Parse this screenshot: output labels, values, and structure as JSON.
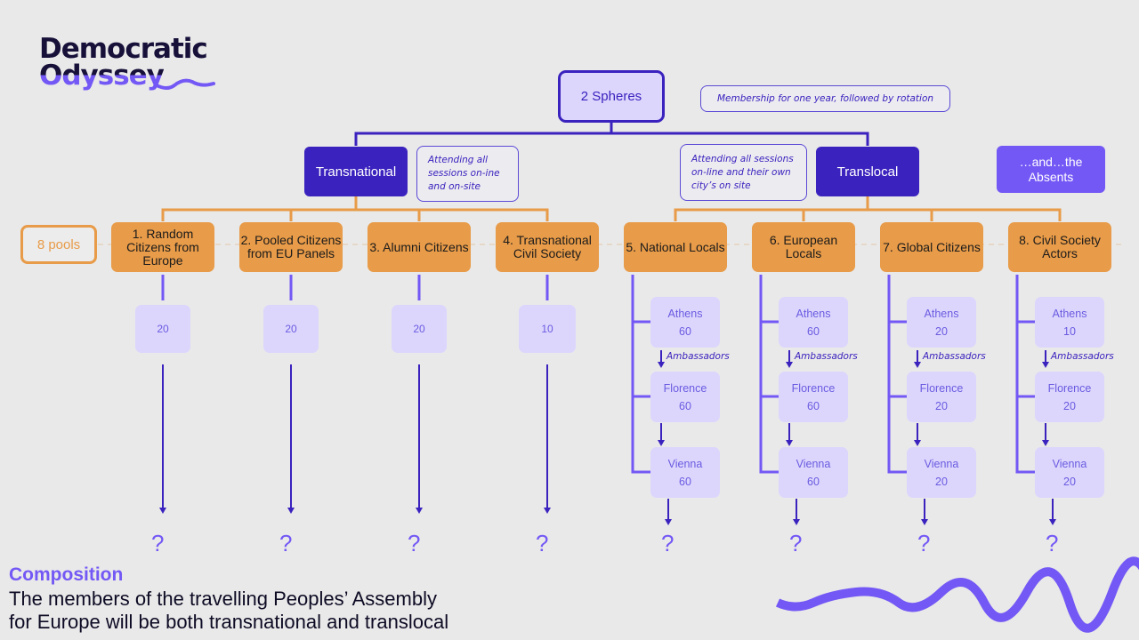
{
  "logo": {
    "line1": "Democratic",
    "line2": "Odyssey"
  },
  "colors": {
    "dark_purple": "#3a22be",
    "mid_purple": "#7458f5",
    "light_purple": "#dcd6fd",
    "orange": "#e89b48",
    "background": "#e9e9e9"
  },
  "root": {
    "label": "2 Spheres",
    "note": "Membership for one year, followed by rotation"
  },
  "spheres": {
    "transnational": {
      "label": "Transnational",
      "note": "Attending all sessions on-ine and on-site"
    },
    "translocal": {
      "label": "Translocal",
      "note": "Attending all sessions on-line and their own city’s on site"
    },
    "absents": {
      "label": "…and…the Absents"
    }
  },
  "pools_label": "8 pools",
  "pools": [
    {
      "label": "1. Random Citizens from Europe",
      "count": "20"
    },
    {
      "label": "2. Pooled Citizens from EU Panels",
      "count": "20"
    },
    {
      "label": "3. Alumni Citizens",
      "count": "20"
    },
    {
      "label": "4. Transnational Civil Society",
      "count": "10"
    },
    {
      "label": "5. National Locals",
      "cities": [
        {
          "name": "Athens",
          "count": "60"
        },
        {
          "name": "Florence",
          "count": "60"
        },
        {
          "name": "Vienna",
          "count": "60"
        }
      ]
    },
    {
      "label": "6. European Locals",
      "cities": [
        {
          "name": "Athens",
          "count": "60"
        },
        {
          "name": "Florence",
          "count": "60"
        },
        {
          "name": "Vienna",
          "count": "60"
        }
      ]
    },
    {
      "label": "7. Global Citizens",
      "cities": [
        {
          "name": "Athens",
          "count": "20"
        },
        {
          "name": "Florence",
          "count": "20"
        },
        {
          "name": "Vienna",
          "count": "20"
        }
      ]
    },
    {
      "label": "8. Civil Society Actors",
      "cities": [
        {
          "name": "Athens",
          "count": "10"
        },
        {
          "name": "Florence",
          "count": "20"
        },
        {
          "name": "Vienna",
          "count": "20"
        }
      ]
    }
  ],
  "ambassadors_label": "Ambassadors",
  "unknown_outcome": "?",
  "composition": {
    "title": "Composition",
    "line1": "The members of the travelling Peoples’ Assembly",
    "line2": "for Europe will be both transnational and translocal"
  }
}
